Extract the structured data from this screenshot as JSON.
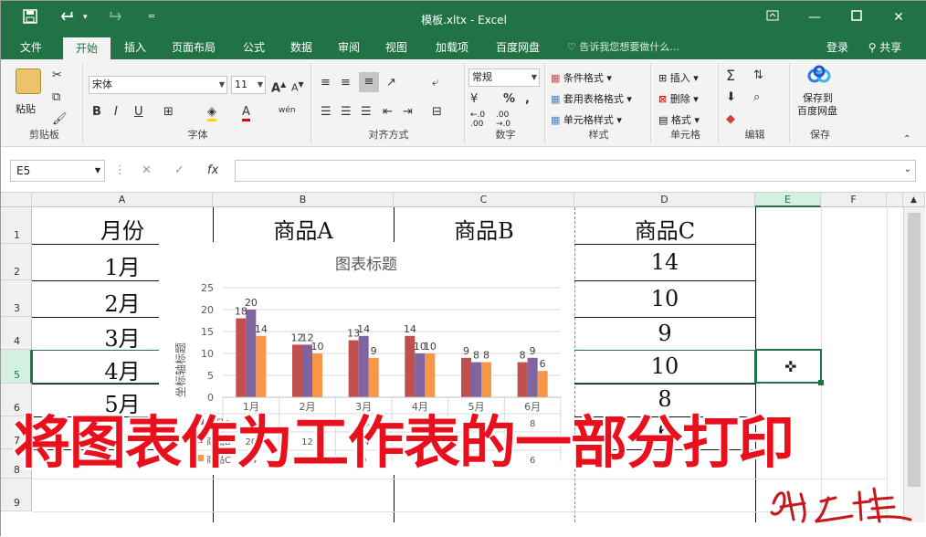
{
  "window": {
    "title": "模板.xltx - Excel"
  },
  "qat": {
    "save_icon": "save-icon",
    "undo_icon": "undo-icon",
    "redo_icon": "redo-icon",
    "more": "▾"
  },
  "tabs": [
    "文件",
    "开始",
    "插入",
    "页面布局",
    "公式",
    "数据",
    "审阅",
    "视图",
    "加载项",
    "百度网盘"
  ],
  "active_tab": "开始",
  "tellme": "告诉我您想要做什么...",
  "account": {
    "login": "登录",
    "share": "共享"
  },
  "ribbon": {
    "clipboard": {
      "paste": "粘贴",
      "label": "剪贴板"
    },
    "font": {
      "name": "宋体",
      "size": "11",
      "bold": "B",
      "italic": "I",
      "underline": "U",
      "phonetic": "wén",
      "label": "字体"
    },
    "alignment": {
      "label": "对齐方式"
    },
    "number": {
      "format": "常规",
      "percent": "%",
      "comma": ",",
      "inc": ".00",
      "dec": ".00",
      "inc_sub": "←.0",
      "dec_sub": "→.0",
      "label": "数字"
    },
    "styles": {
      "conditional": "条件格式",
      "table": "套用表格格式",
      "cell": "单元格样式",
      "label": "样式"
    },
    "cells": {
      "insert": "插入",
      "delete": "删除",
      "format": "格式",
      "label": "单元格"
    },
    "editing": {
      "sum": "Σ",
      "label": "编辑"
    },
    "save": {
      "line1": "保存到",
      "line2": "百度网盘",
      "label": "保存"
    }
  },
  "formula_bar": {
    "name_box": "E5",
    "cancel": "✕",
    "enter": "✓",
    "fx": "fx",
    "value": ""
  },
  "columns": [
    "A",
    "B",
    "C",
    "D",
    "E",
    "F"
  ],
  "rows": [
    "1",
    "2",
    "3",
    "4",
    "5",
    "6",
    "7",
    "8",
    "9"
  ],
  "cells": {
    "A1": "月份",
    "B1": "商品A",
    "C1": "商品B",
    "D1": "商品C",
    "A2": "1月",
    "A3": "2月",
    "A4": "3月",
    "A5": "4月",
    "A6": "5月",
    "D2": "14",
    "D3": "10",
    "D4": "9",
    "D5": "10",
    "D6": "8",
    "D7": "6"
  },
  "chart_data": {
    "type": "bar",
    "title": "图表标题",
    "ylabel": "坐标轴标题",
    "ylim": [
      0,
      25
    ],
    "yticks": [
      0,
      5,
      10,
      15,
      20,
      25
    ],
    "grid": true,
    "categories": [
      "1月",
      "2月",
      "3月",
      "4月",
      "5月",
      "6月"
    ],
    "series": [
      {
        "name": "商品A",
        "color": "#c0504d",
        "values": [
          18,
          12,
          13,
          14,
          9,
          8
        ]
      },
      {
        "name": "商品B",
        "color": "#8064a2",
        "values": [
          20,
          12,
          14,
          10,
          8,
          9
        ]
      },
      {
        "name": "商品C",
        "color": "#f79646",
        "values": [
          14,
          10,
          9,
          10,
          8,
          6
        ]
      }
    ]
  },
  "overlay_caption": "将图表作为工作表的一部分打印",
  "signature": "易之峰",
  "colors": {
    "excel_green": "#217346",
    "caption_red": "#e8101d"
  }
}
